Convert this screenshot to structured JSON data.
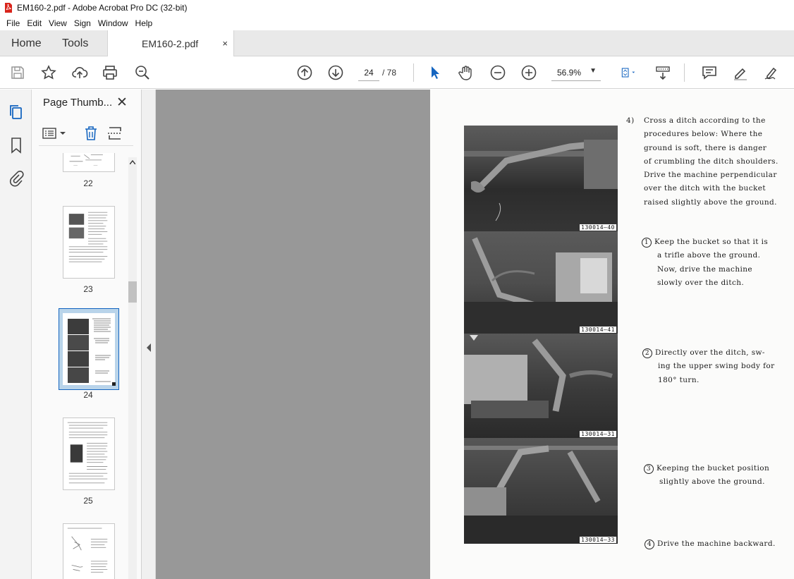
{
  "window": {
    "title": "EM160-2.pdf - Adobe Acrobat Pro DC (32-bit)"
  },
  "menu": [
    "File",
    "Edit",
    "View",
    "Sign",
    "Window",
    "Help"
  ],
  "tabs": {
    "home": "Home",
    "tools": "Tools",
    "document": "EM160-2.pdf",
    "close": "×"
  },
  "toolbar": {
    "page_current": "24",
    "page_total": "/ 78",
    "zoom": "56.9%"
  },
  "panel": {
    "title": "Page Thumb...",
    "close": "✕",
    "thumbnails": [
      "22",
      "23",
      "24",
      "25"
    ],
    "selected": "24"
  },
  "document": {
    "photo_codes": [
      "130014—40",
      "130014—41",
      "130014—31",
      "130014—33"
    ],
    "intro_number": "4)",
    "intro_lines": [
      "Cross a ditch according to the",
      "procedures below:  Where the",
      "ground is soft, there is danger",
      "of crumbling the ditch shoulders.",
      "Drive the machine perpendicular",
      "over the ditch with the bucket",
      "raised slightly above the ground."
    ],
    "steps": [
      {
        "num": "1",
        "lines": [
          "Keep the bucket so that it is",
          "a trifle above the ground.",
          "Now, drive the machine",
          "slowly over the ditch."
        ]
      },
      {
        "num": "2",
        "lines": [
          "Directly over the ditch, sw-",
          "ing the upper swing body for",
          "180° turn."
        ]
      },
      {
        "num": "3",
        "lines": [
          "Keeping the bucket position",
          "slightly above the ground."
        ]
      },
      {
        "num": "4",
        "lines": [
          "Drive the machine backward."
        ]
      }
    ]
  },
  "colors": {
    "app_icon": "#d9251c",
    "select_tool": "#1565c0",
    "canvas_bg": "#989898",
    "selected_thumb": "#b9d4ea"
  }
}
